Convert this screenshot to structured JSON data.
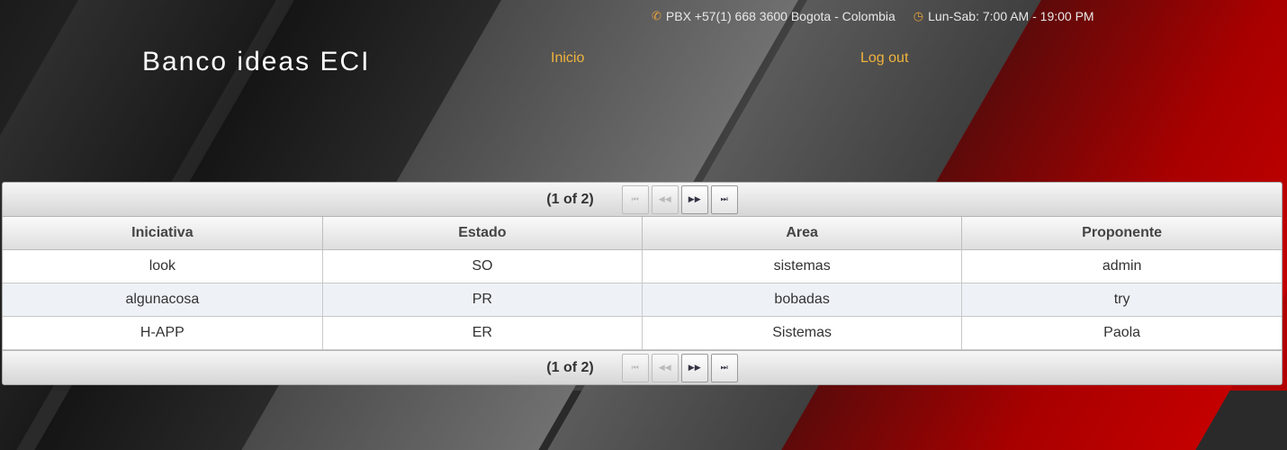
{
  "header": {
    "phone": "PBX +57(1) 668 3600 Bogota - Colombia",
    "hours": "Lun-Sab: 7:00 AM - 19:00 PM",
    "brand": "Banco ideas ECI",
    "nav": {
      "inicio": "Inicio",
      "logout": "Log out"
    }
  },
  "table": {
    "paginator": {
      "report": "(1 of 2)",
      "first": "⏮",
      "prev": "◀◀",
      "next": "▶▶",
      "last": "⏭"
    },
    "columns": [
      "Iniciativa",
      "Estado",
      "Area",
      "Proponente"
    ],
    "rows": [
      [
        "look",
        "SO",
        "sistemas",
        "admin"
      ],
      [
        "algunacosa",
        "PR",
        "bobadas",
        "try"
      ],
      [
        "H-APP",
        "ER",
        "Sistemas",
        "Paola"
      ]
    ]
  },
  "icons": {
    "phone": "phone-icon",
    "clock": "clock-icon"
  },
  "colors": {
    "accent": "#f0b43c",
    "row_alt": "#eef2f7"
  }
}
